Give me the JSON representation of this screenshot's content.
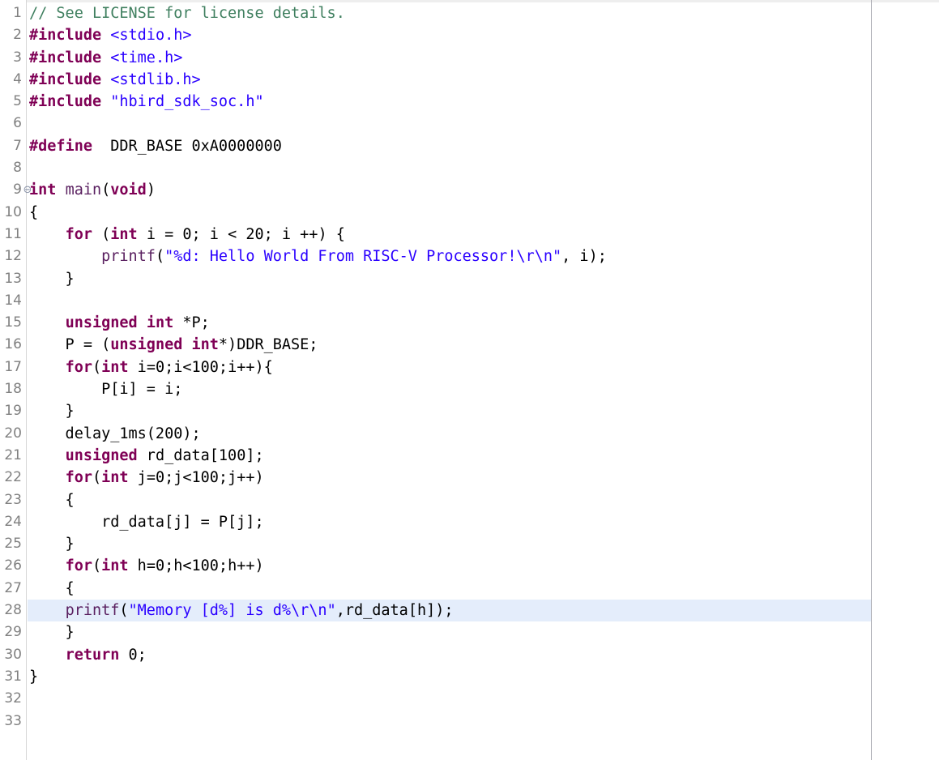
{
  "editor": {
    "name": "c-source-editor",
    "language": "C",
    "total_lines_visible": 33,
    "current_line": 28,
    "colors": {
      "background": "#ffffff",
      "current_line_highlight": "#e4edfb",
      "line_number": "#808080",
      "gutter_border": "#d6d6d6",
      "print_margin_ruler": "#a9aab2",
      "comment": "#3f7f5f",
      "keyword": "#7f0055",
      "preprocessor": "#7f0055",
      "string": "#2a00ff",
      "plain_text": "#000000",
      "function_name": "#5a2060"
    },
    "fold_marker_glyph": "⊖"
  },
  "lines": [
    {
      "n": "1",
      "fold": "",
      "tokens": [
        {
          "t": "comment",
          "s": "// See LICENSE for license details."
        }
      ]
    },
    {
      "n": "2",
      "fold": "",
      "tokens": [
        {
          "t": "preproc",
          "s": "#include"
        },
        {
          "t": "plain",
          "s": " "
        },
        {
          "t": "string",
          "s": "<stdio.h>"
        }
      ]
    },
    {
      "n": "3",
      "fold": "",
      "tokens": [
        {
          "t": "preproc",
          "s": "#include"
        },
        {
          "t": "plain",
          "s": " "
        },
        {
          "t": "string",
          "s": "<time.h>"
        }
      ]
    },
    {
      "n": "4",
      "fold": "",
      "tokens": [
        {
          "t": "preproc",
          "s": "#include"
        },
        {
          "t": "plain",
          "s": " "
        },
        {
          "t": "string",
          "s": "<stdlib.h>"
        }
      ]
    },
    {
      "n": "5",
      "fold": "",
      "tokens": [
        {
          "t": "preproc",
          "s": "#include"
        },
        {
          "t": "plain",
          "s": " "
        },
        {
          "t": "string",
          "s": "\"hbird_sdk_soc.h\""
        }
      ]
    },
    {
      "n": "6",
      "fold": "",
      "tokens": []
    },
    {
      "n": "7",
      "fold": "",
      "tokens": [
        {
          "t": "preproc",
          "s": "#define"
        },
        {
          "t": "plain",
          "s": "  DDR_BASE 0xA0000000"
        }
      ]
    },
    {
      "n": "8",
      "fold": "",
      "tokens": []
    },
    {
      "n": "9",
      "fold": "⊖",
      "tokens": [
        {
          "t": "keyword",
          "s": "int"
        },
        {
          "t": "plain",
          "s": " "
        },
        {
          "t": "func",
          "s": "main"
        },
        {
          "t": "plain",
          "s": "("
        },
        {
          "t": "keyword",
          "s": "void"
        },
        {
          "t": "plain",
          "s": ")"
        }
      ]
    },
    {
      "n": "10",
      "fold": "",
      "tokens": [
        {
          "t": "plain",
          "s": "{"
        }
      ]
    },
    {
      "n": "11",
      "fold": "",
      "tokens": [
        {
          "t": "plain",
          "s": "    "
        },
        {
          "t": "keyword",
          "s": "for"
        },
        {
          "t": "plain",
          "s": " ("
        },
        {
          "t": "keyword",
          "s": "int"
        },
        {
          "t": "plain",
          "s": " i = 0; i < 20; i ++) {"
        }
      ]
    },
    {
      "n": "12",
      "fold": "",
      "tokens": [
        {
          "t": "plain",
          "s": "        "
        },
        {
          "t": "func",
          "s": "printf"
        },
        {
          "t": "plain",
          "s": "("
        },
        {
          "t": "string",
          "s": "\"%d: Hello World From RISC-V Processor!\\r\\n\""
        },
        {
          "t": "plain",
          "s": ", i);"
        }
      ]
    },
    {
      "n": "13",
      "fold": "",
      "tokens": [
        {
          "t": "plain",
          "s": "    }"
        }
      ]
    },
    {
      "n": "14",
      "fold": "",
      "tokens": []
    },
    {
      "n": "15",
      "fold": "",
      "tokens": [
        {
          "t": "plain",
          "s": "    "
        },
        {
          "t": "keyword",
          "s": "unsigned"
        },
        {
          "t": "plain",
          "s": " "
        },
        {
          "t": "keyword",
          "s": "int"
        },
        {
          "t": "plain",
          "s": " *P;"
        }
      ]
    },
    {
      "n": "16",
      "fold": "",
      "tokens": [
        {
          "t": "plain",
          "s": "    P = ("
        },
        {
          "t": "keyword",
          "s": "unsigned"
        },
        {
          "t": "plain",
          "s": " "
        },
        {
          "t": "keyword",
          "s": "int"
        },
        {
          "t": "plain",
          "s": "*)DDR_BASE;"
        }
      ]
    },
    {
      "n": "17",
      "fold": "",
      "tokens": [
        {
          "t": "plain",
          "s": "    "
        },
        {
          "t": "keyword",
          "s": "for"
        },
        {
          "t": "plain",
          "s": "("
        },
        {
          "t": "keyword",
          "s": "int"
        },
        {
          "t": "plain",
          "s": " i=0;i<100;i++){"
        }
      ]
    },
    {
      "n": "18",
      "fold": "",
      "tokens": [
        {
          "t": "plain",
          "s": "        P[i] = i;"
        }
      ]
    },
    {
      "n": "19",
      "fold": "",
      "tokens": [
        {
          "t": "plain",
          "s": "    }"
        }
      ]
    },
    {
      "n": "20",
      "fold": "",
      "tokens": [
        {
          "t": "plain",
          "s": "    delay_1ms(200);"
        }
      ]
    },
    {
      "n": "21",
      "fold": "",
      "tokens": [
        {
          "t": "plain",
          "s": "    "
        },
        {
          "t": "keyword",
          "s": "unsigned"
        },
        {
          "t": "plain",
          "s": " rd_data[100];"
        }
      ]
    },
    {
      "n": "22",
      "fold": "",
      "tokens": [
        {
          "t": "plain",
          "s": "    "
        },
        {
          "t": "keyword",
          "s": "for"
        },
        {
          "t": "plain",
          "s": "("
        },
        {
          "t": "keyword",
          "s": "int"
        },
        {
          "t": "plain",
          "s": " j=0;j<100;j++)"
        }
      ]
    },
    {
      "n": "23",
      "fold": "",
      "tokens": [
        {
          "t": "plain",
          "s": "    {"
        }
      ]
    },
    {
      "n": "24",
      "fold": "",
      "tokens": [
        {
          "t": "plain",
          "s": "        rd_data[j] = P[j];"
        }
      ]
    },
    {
      "n": "25",
      "fold": "",
      "tokens": [
        {
          "t": "plain",
          "s": "    }"
        }
      ]
    },
    {
      "n": "26",
      "fold": "",
      "tokens": [
        {
          "t": "plain",
          "s": "    "
        },
        {
          "t": "keyword",
          "s": "for"
        },
        {
          "t": "plain",
          "s": "("
        },
        {
          "t": "keyword",
          "s": "int"
        },
        {
          "t": "plain",
          "s": " h=0;h<100;h++)"
        }
      ]
    },
    {
      "n": "27",
      "fold": "",
      "tokens": [
        {
          "t": "plain",
          "s": "    {"
        }
      ]
    },
    {
      "n": "28",
      "fold": "",
      "current": true,
      "tokens": [
        {
          "t": "plain",
          "s": "    "
        },
        {
          "t": "func",
          "s": "printf"
        },
        {
          "t": "plain",
          "s": "("
        },
        {
          "t": "string",
          "s": "\"Memory [d%] is d%\\r\\n\""
        },
        {
          "t": "plain",
          "s": ",rd_data[h]);"
        }
      ]
    },
    {
      "n": "29",
      "fold": "",
      "tokens": [
        {
          "t": "plain",
          "s": "    }"
        }
      ]
    },
    {
      "n": "30",
      "fold": "",
      "tokens": [
        {
          "t": "plain",
          "s": "    "
        },
        {
          "t": "keyword",
          "s": "return"
        },
        {
          "t": "plain",
          "s": " 0;"
        }
      ]
    },
    {
      "n": "31",
      "fold": "",
      "tokens": [
        {
          "t": "plain",
          "s": "}"
        }
      ]
    },
    {
      "n": "32",
      "fold": "",
      "tokens": []
    },
    {
      "n": "33",
      "fold": "",
      "tokens": []
    }
  ]
}
